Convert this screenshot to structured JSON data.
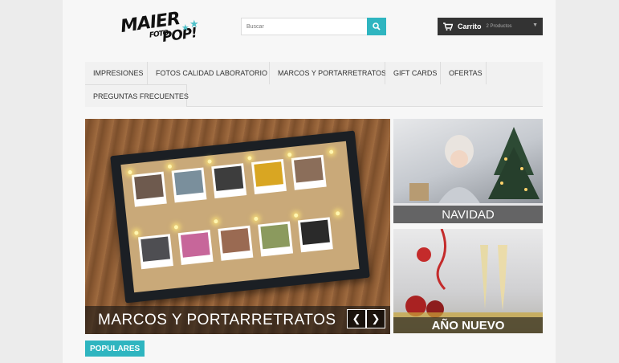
{
  "header": {
    "logo": {
      "line1": "MAIER",
      "line2": "FOTO",
      "line3": "POP!"
    },
    "search": {
      "placeholder": "Buscar"
    },
    "cart": {
      "label": "Carrito",
      "count": "2 Productos"
    }
  },
  "nav": {
    "items": [
      {
        "label": "IMPRESIONES"
      },
      {
        "label": "FOTOS CALIDAD LABORATORIO"
      },
      {
        "label": "MARCOS Y PORTARRETRATOS"
      },
      {
        "label": "GIFT CARDS"
      },
      {
        "label": "OFERTAS"
      },
      {
        "label": "PREGUNTAS FRECUENTES"
      }
    ]
  },
  "slider": {
    "caption": "MARCOS Y PORTARRETRATOS",
    "prev_icon": "chevron-left-icon",
    "next_icon": "chevron-right-icon",
    "prev_glyph": "❮",
    "next_glyph": "❯"
  },
  "banners": [
    {
      "caption": "NAVIDAD"
    },
    {
      "caption": "AÑO NUEVO"
    }
  ],
  "sections": {
    "populares": "POPULARES"
  },
  "colors": {
    "accent": "#2fb5c0",
    "cart_bg": "#333333"
  }
}
